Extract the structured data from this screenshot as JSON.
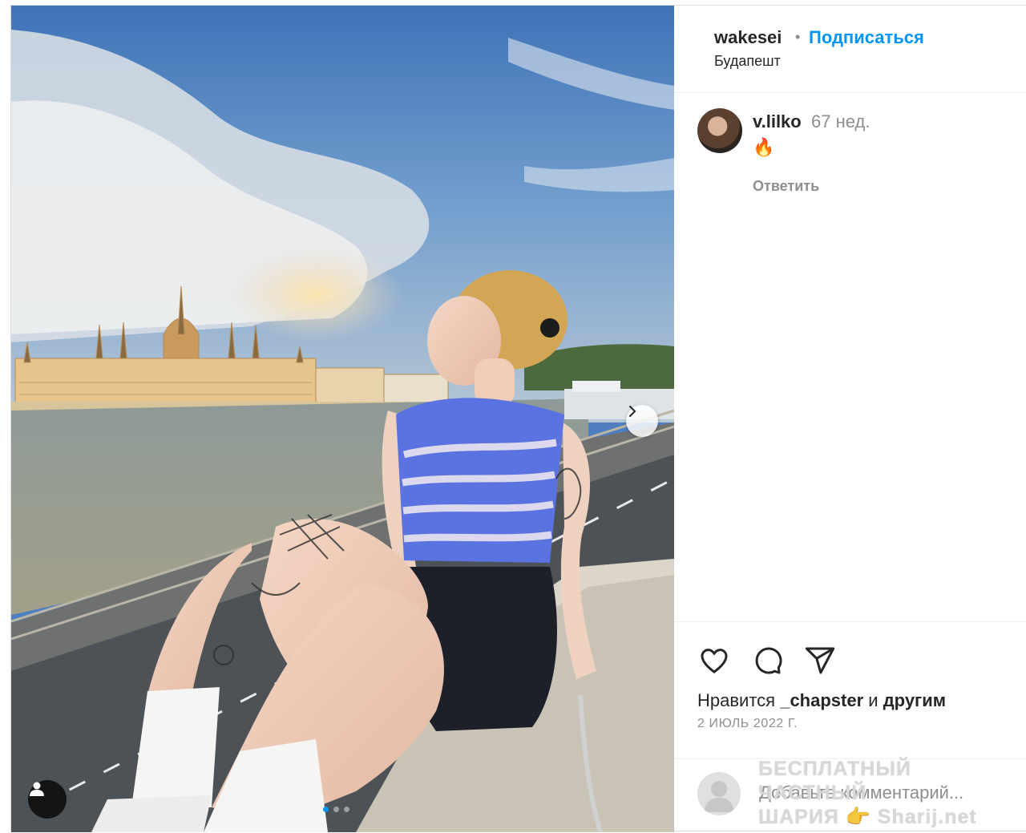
{
  "header": {
    "username": "wakesei",
    "separator": "•",
    "follow_label": "Подписаться",
    "location": "Будапешт"
  },
  "comments": [
    {
      "user": "v.lilko",
      "time": "67 нед.",
      "text": "🔥",
      "reply_label": "Ответить"
    }
  ],
  "actions": {
    "icons": [
      "heart-icon",
      "comment-icon",
      "share-icon"
    ]
  },
  "likes": {
    "prefix": "Нравится",
    "user": "_chapster",
    "conjunction": "и",
    "suffix": "другим"
  },
  "date": "2 ИЮЛЬ 2022 Г.",
  "add_comment": {
    "placeholder": "Добавьте комментарий..."
  },
  "carousel": {
    "slide_count": 3,
    "active_index": 0
  },
  "watermark": {
    "line1": "БЕСПЛАТНЫЙ ЧАСТНЫЙ",
    "line2": "ШАРИЯ 👉 Sharij.net"
  },
  "colors": {
    "accent": "#0095f6",
    "muted": "#8e8e8e",
    "text": "#262626"
  }
}
